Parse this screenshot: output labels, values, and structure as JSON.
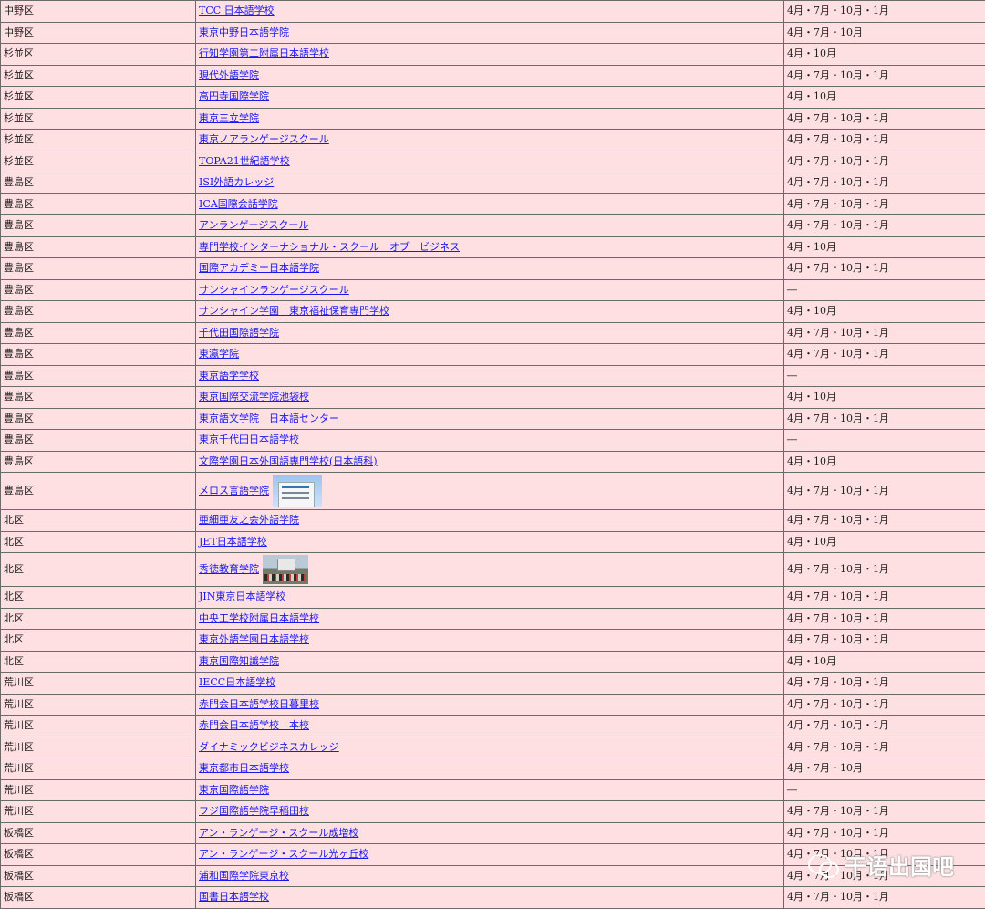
{
  "table": {
    "rows": [
      {
        "ward": "中野区",
        "school": "TCC 日本語学校",
        "intake": "4月・7月・10月・1月"
      },
      {
        "ward": "中野区",
        "school": "東京中野日本語学院",
        "intake": "4月・7月・10月"
      },
      {
        "ward": "杉並区",
        "school": "行知学園第二附属日本語学校",
        "intake": "4月・10月"
      },
      {
        "ward": "杉並区",
        "school": "現代外語学院",
        "intake": "4月・7月・10月・1月"
      },
      {
        "ward": "杉並区",
        "school": "高円寺国際学院",
        "intake": "4月・10月"
      },
      {
        "ward": "杉並区",
        "school": "東京三立学院",
        "intake": "4月・7月・10月・1月"
      },
      {
        "ward": "杉並区",
        "school": "東京ノアランゲージスクール",
        "intake": "4月・7月・10月・1月"
      },
      {
        "ward": "杉並区",
        "school": "TOPA21世紀語学校",
        "intake": "4月・7月・10月・1月"
      },
      {
        "ward": "豊島区",
        "school": "ISI外語カレッジ",
        "intake": "4月・7月・10月・1月"
      },
      {
        "ward": "豊島区",
        "school": "ICA国際会話学院",
        "intake": "4月・7月・10月・1月"
      },
      {
        "ward": "豊島区",
        "school": "アンランゲージスクール",
        "intake": "4月・7月・10月・1月"
      },
      {
        "ward": "豊島区",
        "school": "専門学校インターナショナル・スクール　オブ　ビジネス",
        "intake": "4月・10月"
      },
      {
        "ward": "豊島区",
        "school": "国際アカデミー日本語学院",
        "intake": "4月・7月・10月・1月"
      },
      {
        "ward": "豊島区",
        "school": "サンシャインランゲージスクール",
        "intake": "―"
      },
      {
        "ward": "豊島区",
        "school": "サンシャイン学園　東京福祉保育専門学校",
        "intake": "4月・10月"
      },
      {
        "ward": "豊島区",
        "school": "千代田国際語学院",
        "intake": "4月・7月・10月・1月"
      },
      {
        "ward": "豊島区",
        "school": "東瀛学院",
        "intake": "4月・7月・10月・1月"
      },
      {
        "ward": "豊島区",
        "school": "東京語学学校",
        "intake": "―"
      },
      {
        "ward": "豊島区",
        "school": "東京国際交流学院池袋校",
        "intake": "4月・10月"
      },
      {
        "ward": "豊島区",
        "school": "東京語文学院　日本語センター",
        "intake": "4月・7月・10月・1月"
      },
      {
        "ward": "豊島区",
        "school": "東京千代田日本語学校",
        "intake": "―"
      },
      {
        "ward": "豊島区",
        "school": "文際学園日本外国語専門学校(日本語科)",
        "intake": "4月・10月"
      },
      {
        "ward": "豊島区",
        "school": "メロス言語学院",
        "intake": "4月・7月・10月・1月",
        "thumb": "building"
      },
      {
        "ward": "北区",
        "school": "亜細亜友之会外語学院",
        "intake": "4月・7月・10月・1月"
      },
      {
        "ward": "北区",
        "school": "JET日本語学校",
        "intake": "4月・10月"
      },
      {
        "ward": "北区",
        "school": "秀徳教育学院",
        "intake": "4月・7月・10月・1月",
        "thumb": "group"
      },
      {
        "ward": "北区",
        "school": "JIN東京日本語学校",
        "intake": "4月・7月・10月・1月"
      },
      {
        "ward": "北区",
        "school": "中央工学校附属日本語学校",
        "intake": "4月・7月・10月・1月"
      },
      {
        "ward": "北区",
        "school": "東京外語学園日本語学校",
        "intake": "4月・7月・10月・1月"
      },
      {
        "ward": "北区",
        "school": "東京国際知識学院",
        "intake": "4月・10月"
      },
      {
        "ward": "荒川区",
        "school": "IECC日本語学校",
        "intake": "4月・7月・10月・1月"
      },
      {
        "ward": "荒川区",
        "school": "赤門会日本語学校日暮里校",
        "intake": "4月・7月・10月・1月"
      },
      {
        "ward": "荒川区",
        "school": "赤門会日本語学校　本校",
        "intake": "4月・7月・10月・1月"
      },
      {
        "ward": "荒川区",
        "school": "ダイナミックビジネスカレッジ",
        "intake": "4月・7月・10月・1月"
      },
      {
        "ward": "荒川区",
        "school": "東京都市日本語学校",
        "intake": "4月・7月・10月"
      },
      {
        "ward": "荒川区",
        "school": "東京国際語学院",
        "intake": "―"
      },
      {
        "ward": "荒川区",
        "school": "フジ国際語学院早稲田校",
        "intake": "4月・7月・10月・1月"
      },
      {
        "ward": "板橋区",
        "school": "アン・ランゲージ・スクール成増校",
        "intake": "4月・7月・10月・1月"
      },
      {
        "ward": "板橋区",
        "school": "アン・ランゲージ・スクール光ヶ丘校",
        "intake": "4月・7月・10月・1月"
      },
      {
        "ward": "板橋区",
        "school": "浦和国際学院東京校",
        "intake": "4月・7月・10月・1月"
      },
      {
        "ward": "板橋区",
        "school": "国書日本語学校",
        "intake": "4月・7月・10月・1月"
      }
    ]
  },
  "watermark": {
    "text": "干语出国吧",
    "icon": "wechat-icon"
  }
}
